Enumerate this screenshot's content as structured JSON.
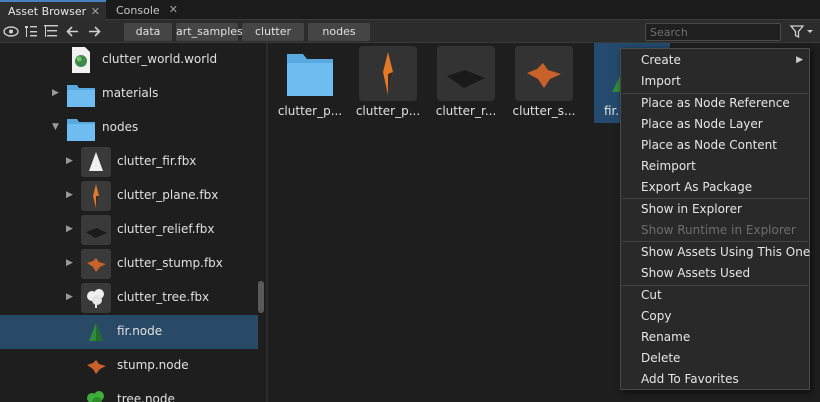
{
  "tabs": [
    {
      "label": "Asset Browser",
      "active": true
    },
    {
      "label": "Console",
      "active": false
    }
  ],
  "toolbar": {
    "breadcrumbs": [
      "data",
      "art_samples",
      "clutter",
      "nodes"
    ],
    "search_placeholder": "Search",
    "icons": [
      "eye-icon",
      "tree-collapse-icon",
      "tree-expand-icon",
      "back-arrow-icon",
      "forward-arrow-icon",
      "filter-icon"
    ]
  },
  "tree": [
    {
      "label": "clutter_world.world",
      "icon": "world-icon",
      "expander": "none"
    },
    {
      "label": "materials",
      "icon": "folder-icon",
      "expander": "collapsed"
    },
    {
      "label": "nodes",
      "icon": "folder-icon",
      "expander": "expanded"
    },
    {
      "label": "clutter_fir.fbx",
      "icon": "fir-mesh-icon",
      "expander": "collapsed"
    },
    {
      "label": "clutter_plane.fbx",
      "icon": "plane-mesh-icon",
      "expander": "collapsed"
    },
    {
      "label": "clutter_relief.fbx",
      "icon": "relief-mesh-icon",
      "expander": "collapsed"
    },
    {
      "label": "clutter_stump.fbx",
      "icon": "stump-mesh-icon",
      "expander": "collapsed"
    },
    {
      "label": "clutter_tree.fbx",
      "icon": "tree-mesh-icon",
      "expander": "collapsed"
    },
    {
      "label": "fir.node",
      "icon": "fir-node-icon",
      "expander": "none",
      "selected": true
    },
    {
      "label": "stump.node",
      "icon": "stump-node-icon",
      "expander": "none"
    },
    {
      "label": "tree.node",
      "icon": "tree-node-icon",
      "expander": "none"
    }
  ],
  "grid": [
    {
      "label": "clutter_p...",
      "icon": "folder-icon"
    },
    {
      "label": "clutter_p...",
      "icon": "plane-mesh-icon"
    },
    {
      "label": "clutter_r...",
      "icon": "relief-mesh-icon"
    },
    {
      "label": "clutter_s...",
      "icon": "stump-mesh-icon"
    },
    {
      "label": "fir.",
      "icon": "fir-node-icon",
      "selected": true
    }
  ],
  "context_menu": [
    {
      "label": "Create",
      "submenu": true
    },
    {
      "label": "Import"
    },
    {
      "separator": true
    },
    {
      "label": "Place as Node Reference"
    },
    {
      "label": "Place as Node Layer"
    },
    {
      "label": "Place as Node Content"
    },
    {
      "label": "Reimport"
    },
    {
      "label": "Export As Package"
    },
    {
      "separator": true
    },
    {
      "label": "Show in Explorer"
    },
    {
      "label": "Show Runtime in Explorer",
      "disabled": true
    },
    {
      "separator": true
    },
    {
      "label": "Show Assets Using This One"
    },
    {
      "label": "Show Assets Used"
    },
    {
      "separator": true
    },
    {
      "label": "Cut"
    },
    {
      "label": "Copy"
    },
    {
      "label": "Rename"
    },
    {
      "label": "Delete"
    },
    {
      "label": "Add To Favorites"
    }
  ],
  "colors": {
    "selection": "#294a66",
    "folder": "#58a9e0",
    "orange": "#e07a28",
    "green": "#2e8b3a",
    "tab_accent": "#4a7fbf"
  }
}
